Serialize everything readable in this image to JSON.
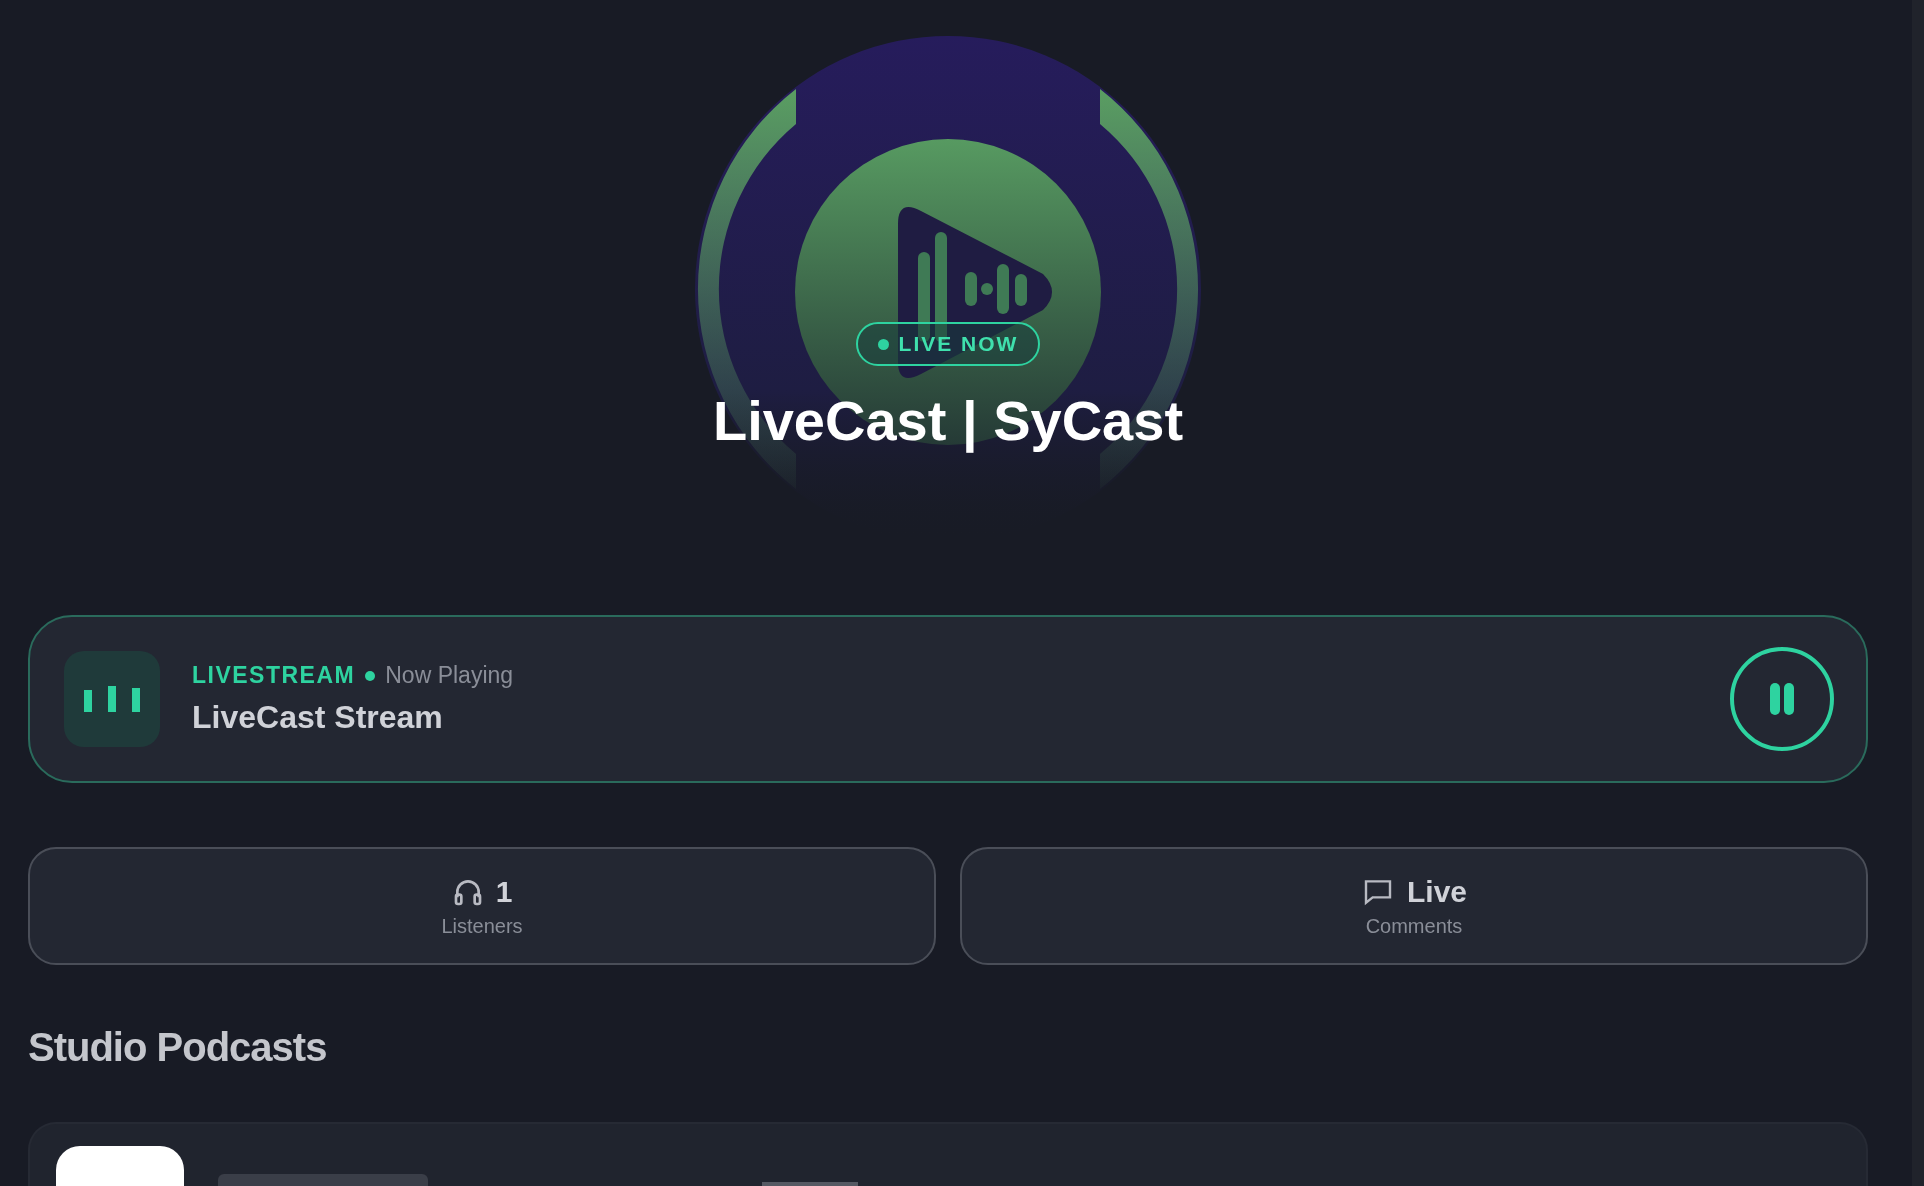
{
  "hero": {
    "badge": "LIVE NOW",
    "title": "LiveCast | SyCast"
  },
  "player": {
    "category": "LIVESTREAM",
    "status": "Now Playing",
    "title": "LiveCast Stream",
    "playing": true
  },
  "stats": [
    {
      "kind": "listeners",
      "value": "1",
      "label": "Listeners"
    },
    {
      "kind": "comments",
      "value": "Live",
      "label": "Comments"
    }
  ],
  "section": {
    "title": "Studio Podcasts"
  }
}
